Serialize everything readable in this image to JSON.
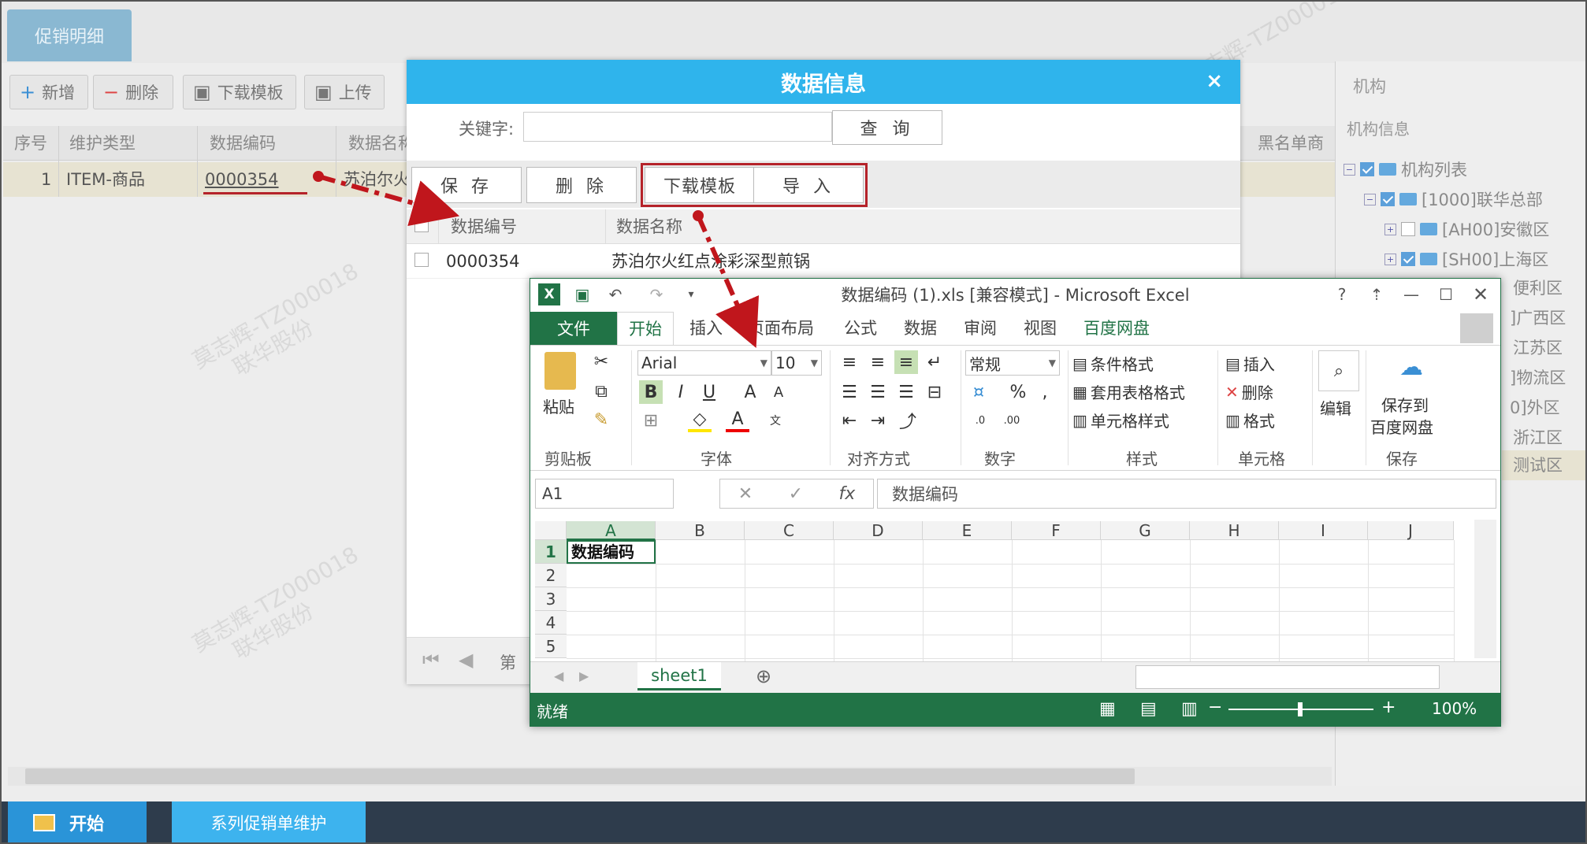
{
  "tabs": {
    "promo_detail": "促销明细"
  },
  "toolbar": {
    "add": "新增",
    "delete": "删除",
    "download_template": "下载模板",
    "upload": "上传"
  },
  "main_grid": {
    "headers": [
      "序号",
      "维护类型",
      "数据编码",
      "数据名称",
      "黑名单商品"
    ],
    "row": {
      "index": "1",
      "type": "ITEM-商品",
      "code": "0000354",
      "name_partial": "苏泊尔火"
    }
  },
  "right_panel": {
    "title": "机构",
    "subtitle": "机构信息",
    "tree": [
      "机构列表",
      "[1000]联华总部",
      "[AH00]安徽区",
      "[SH00]上海区"
    ],
    "fragments": [
      "便利区",
      "]广西区",
      "江苏区",
      "]物流区",
      "0]外区",
      "浙江区",
      "测试区"
    ]
  },
  "watermark": {
    "line1": "莫志辉-TZ000018",
    "line2": "联华股份"
  },
  "dialog": {
    "title": "数据信息",
    "close": "×",
    "keyword_label": "关键字:",
    "keyword_value": "",
    "query": "查 询",
    "save": "保 存",
    "delete": "删 除",
    "download_template": "下载模板",
    "import": "导 入",
    "col_code": "数据编号",
    "col_name": "数据名称",
    "row_code": "0000354",
    "row_name": "苏泊尔火红点涂彩深型煎锅",
    "footer_page": "第"
  },
  "excel": {
    "title": "数据编码 (1).xls  [兼容模式] - Microsoft Excel",
    "file_tab": "文件",
    "tabs": [
      "开始",
      "插入",
      "页面布局",
      "公式",
      "数据",
      "审阅",
      "视图",
      "百度网盘"
    ],
    "groups": {
      "clipboard": "剪贴板",
      "paste": "粘贴",
      "font": "字体",
      "font_name": "Arial",
      "font_size": "10",
      "align": "对齐方式",
      "number": "数字",
      "number_format": "常规",
      "styles": "样式",
      "cond_format": "条件格式",
      "table_format": "套用表格格式",
      "cell_style": "单元格样式",
      "cells": "单元格",
      "insert": "插入",
      "delete": "删除",
      "format": "格式",
      "edit": "编辑",
      "save_group": "保存",
      "save_baidu_1": "保存到",
      "save_baidu_2": "百度网盘"
    },
    "name_box": "A1",
    "formula": "数据编码",
    "columns": [
      "A",
      "B",
      "C",
      "D",
      "E",
      "F",
      "G",
      "H",
      "I",
      "J"
    ],
    "rows": [
      "1",
      "2",
      "3",
      "4",
      "5"
    ],
    "a1_value": "数据编码",
    "sheet_tab": "sheet1",
    "status_ready": "就绪",
    "zoom": "100%"
  },
  "taskbar": {
    "start": "开始",
    "task": "系列促销单维护"
  },
  "colors": {
    "dialog_header": "#2fb4ec",
    "excel_green": "#217346",
    "highlight_red": "#b5232a",
    "taskbar": "#2e3c4c"
  }
}
